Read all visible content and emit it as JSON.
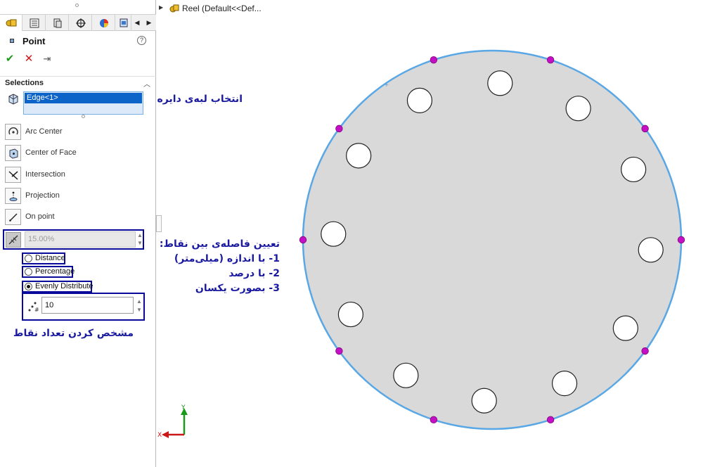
{
  "feature": {
    "title": "Point",
    "help_icon": "question-icon",
    "actions": {
      "ok": "✔",
      "cancel": "✕",
      "pin": "⇥"
    }
  },
  "selections": {
    "header": "Selections",
    "selected_item": "Edge<1>"
  },
  "point_types": [
    {
      "label": "Arc Center",
      "icon": "arc-center-icon"
    },
    {
      "label": "Center of Face",
      "icon": "center-of-face-icon"
    },
    {
      "label": "Intersection",
      "icon": "intersection-icon"
    },
    {
      "label": "Projection",
      "icon": "projection-icon"
    },
    {
      "label": "On point",
      "icon": "on-point-icon"
    }
  ],
  "distance_value": "15.00%",
  "spacing_options": {
    "distance": "Distance",
    "percentage": "Percentage",
    "evenly": "Evenly Distribute",
    "selected": "Evenly Distribute"
  },
  "point_count": "10",
  "annotations": {
    "select_edge": "انتخاب لبه‌ی دایره",
    "spacing_title": "تعیین فاصله‌ی بین نقاط:",
    "spacing_1": "1- با اندازه (میلی‌متر)",
    "spacing_2": "2- با درصد",
    "spacing_3": "3- بصورت یکسان",
    "count_note": "مشخص کردن تعداد نقاط"
  },
  "tree": {
    "label": "Reel  (Default<<Def..."
  },
  "triad": {
    "x_label": "X",
    "y_label": "Y"
  },
  "colors": {
    "disc_fill": "#d9d9d9",
    "edge_highlight": "#5aa7e6",
    "point_marker": "#c40fc4",
    "annotation_box": "#0a0a9a",
    "annotation_text": "#1a1aa0"
  }
}
